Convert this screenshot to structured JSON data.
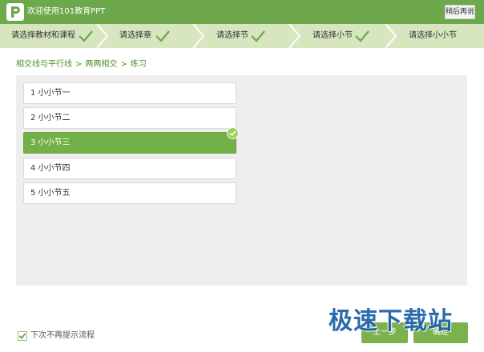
{
  "header": {
    "title": "欢迎使用101教育PPT",
    "later_label": "稍后再说"
  },
  "steps": [
    {
      "label": "请选择教材和课程",
      "done": true
    },
    {
      "label": "请选择章",
      "done": true
    },
    {
      "label": "请选择节",
      "done": true
    },
    {
      "label": "请选择小节",
      "done": true
    },
    {
      "label": "请选择小小节",
      "done": false,
      "current": true
    }
  ],
  "breadcrumb": {
    "items": [
      "相交线与平行线",
      "两两相交",
      "练习"
    ],
    "separator": ">"
  },
  "items": [
    {
      "label": "1 小小节一",
      "selected": false
    },
    {
      "label": "2 小小节二",
      "selected": false
    },
    {
      "label": "3 小小节三",
      "selected": true
    },
    {
      "label": "4 小小节四",
      "selected": false
    },
    {
      "label": "5 小小节五",
      "selected": false
    }
  ],
  "footer": {
    "no_prompt_label": "下次不再提示流程",
    "no_prompt_checked": true,
    "prev_label": "上一步",
    "next_label": "确定"
  },
  "watermark": "极速下载站",
  "colors": {
    "brand_green": "#6ea84c",
    "step_bar": "#d7e6bf",
    "selected_item": "#74b048",
    "link_green": "#4c8f2b"
  }
}
